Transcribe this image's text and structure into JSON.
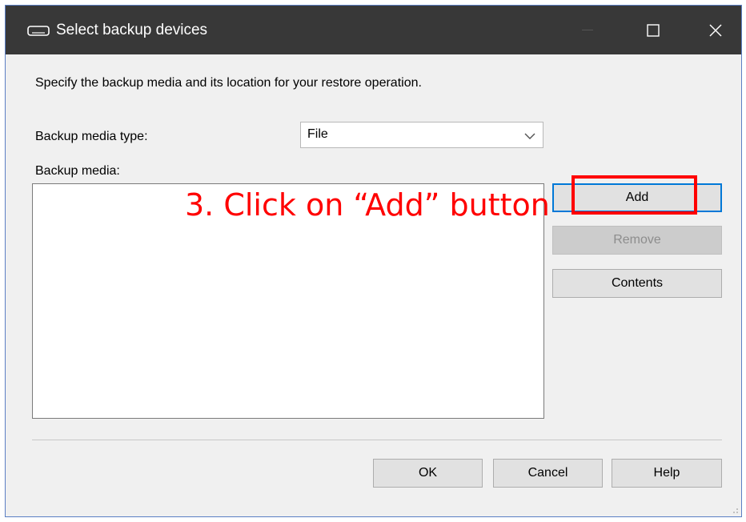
{
  "window": {
    "title": "Select backup devices",
    "icon": "tape-drive-icon",
    "controls": [
      "minimize-icon",
      "maximize-icon",
      "close-icon"
    ]
  },
  "dialog": {
    "description": "Specify the backup media and its location for your restore operation.",
    "media_type_label": "Backup media type:",
    "media_type_value": "File",
    "media_list_label": "Backup media:",
    "media_list_items": []
  },
  "side_buttons": {
    "add": "Add",
    "remove": "Remove",
    "contents": "Contents"
  },
  "footer_buttons": {
    "ok": "OK",
    "cancel": "Cancel",
    "help": "Help"
  },
  "annotation": {
    "text": "3. Click on “Add” button",
    "color": "#ff0000"
  },
  "colors": {
    "titlebar": "#383838",
    "focus_border": "#0078d7",
    "highlight": "#ff0000"
  }
}
